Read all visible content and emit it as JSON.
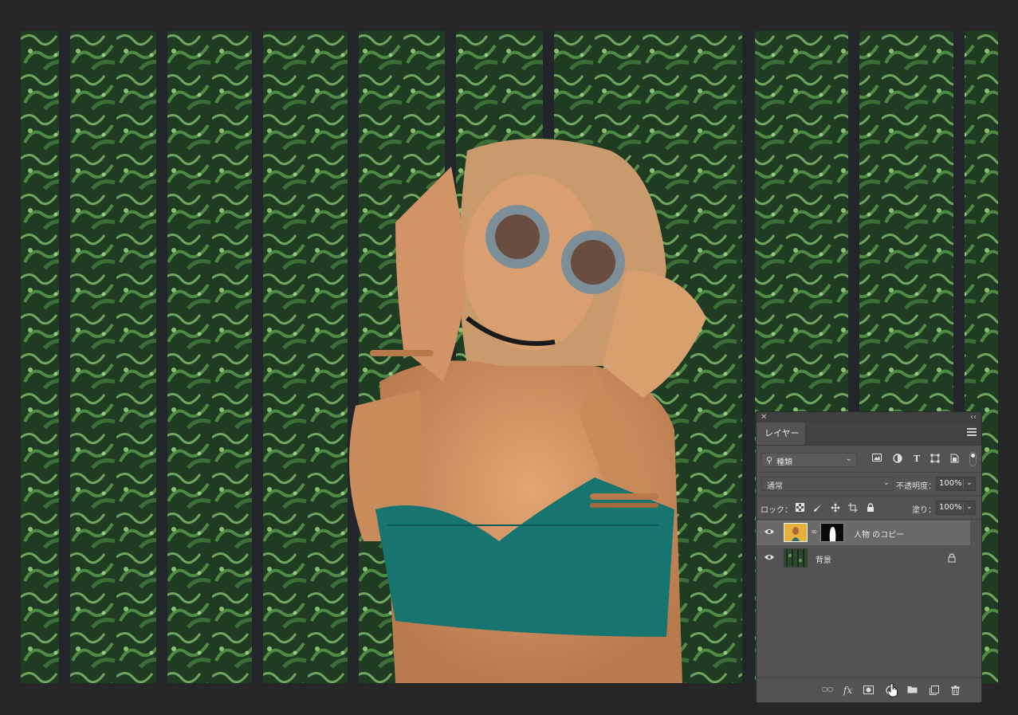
{
  "panel": {
    "tab_label": "レイヤー",
    "filter": {
      "label": "種類"
    },
    "blend_mode": "通常",
    "opacity": {
      "label": "不透明度：",
      "value": "100%"
    },
    "lock": {
      "label": "ロック："
    },
    "fill": {
      "label": "塗り：",
      "value": "100%"
    },
    "layers": [
      {
        "name": "人物 のコピー",
        "selected": true
      },
      {
        "name": "背景",
        "selected": false
      }
    ],
    "icons": {
      "filter": [
        "image-filter-icon",
        "adjustment-filter-icon",
        "type-filter-icon",
        "shape-filter-icon",
        "smart-object-filter-icon"
      ],
      "lock": [
        "lock-transparent-icon",
        "lock-image-icon",
        "lock-position-icon",
        "lock-artboard-icon",
        "lock-all-icon"
      ],
      "bottom": [
        "link-layers-icon",
        "fx-icon",
        "add-mask-icon",
        "new-adjustment-layer-icon",
        "new-group-icon",
        "new-layer-icon",
        "trash-icon"
      ]
    }
  },
  "colors": {
    "app_bg": "#262626",
    "panel_bg": "#535353",
    "selected_layer_bg": "#696969"
  }
}
